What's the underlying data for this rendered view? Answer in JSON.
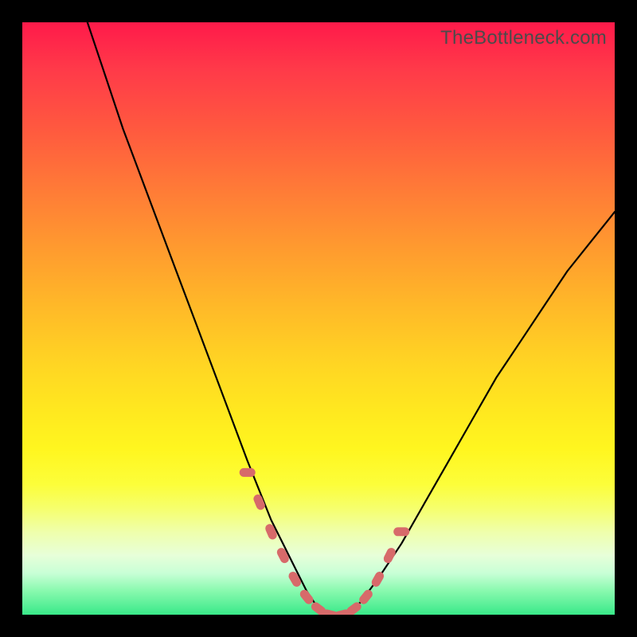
{
  "watermark": "TheBottleneck.com",
  "colors": {
    "curve": "#000000",
    "marker_fill": "#d76a6a",
    "marker_stroke": "#c25757",
    "green_band": "#39e989"
  },
  "chart_data": {
    "type": "line",
    "title": "",
    "xlabel": "",
    "ylabel": "",
    "xlim": [
      0,
      100
    ],
    "ylim": [
      0,
      100
    ],
    "grid": false,
    "legend": false,
    "note": "V-shaped bottleneck curve; y value approximates distance from optimum (0 = perfect match). Axes unlabeled in source image; values estimated from pixel positions.",
    "series": [
      {
        "name": "curve",
        "x": [
          11,
          14,
          17,
          20,
          23,
          26,
          29,
          32,
          35,
          38,
          40,
          42,
          44,
          46,
          48,
          50,
          52,
          54,
          57,
          60,
          64,
          68,
          72,
          76,
          80,
          84,
          88,
          92,
          96,
          100
        ],
        "y": [
          100,
          91,
          82,
          74,
          66,
          58,
          50,
          42,
          34,
          26,
          21,
          16,
          12,
          8,
          4,
          1,
          0,
          0,
          2,
          6,
          12,
          19,
          26,
          33,
          40,
          46,
          52,
          58,
          63,
          68
        ]
      }
    ],
    "markers": {
      "name": "highlighted-range",
      "note": "Pill-shaped salmon markers near valley on both branches and along flat bottom.",
      "x": [
        38,
        40,
        42,
        44,
        46,
        48,
        50,
        52,
        54,
        56,
        58,
        60,
        62,
        64
      ],
      "y": [
        24,
        19,
        14,
        10,
        6,
        3,
        1,
        0,
        0,
        1,
        3,
        6,
        10,
        14
      ]
    }
  }
}
